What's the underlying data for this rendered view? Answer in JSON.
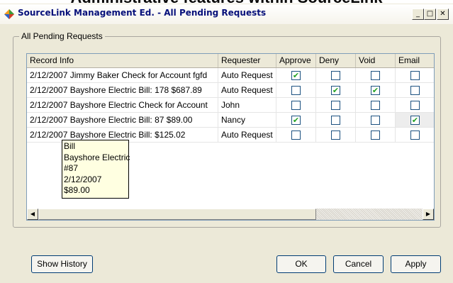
{
  "slide_heading": "Administrative features within SourceLink",
  "window": {
    "title": "SourceLink Management Ed. - All Pending Requests",
    "controls": {
      "minimize": "_",
      "maximize": "□",
      "close": "✕"
    }
  },
  "group": {
    "label": "All Pending Requests"
  },
  "table": {
    "columns": [
      "Record Info",
      "Requester",
      "Approve",
      "Deny",
      "Void",
      "Email"
    ],
    "rows": [
      {
        "record": "2/12/2007 Jimmy Baker Check for Account fgfd",
        "requester": "Auto Request",
        "approve": "✔",
        "deny": "",
        "void": "",
        "email": ""
      },
      {
        "record": "2/12/2007 Bayshore Electric Bill: 178 $687.89",
        "requester": "Auto Request",
        "approve": "",
        "deny": "✔",
        "void": "✔",
        "email": ""
      },
      {
        "record": "2/12/2007 Bayshore Electric Check for Account",
        "requester": "John",
        "approve": "",
        "deny": "",
        "void": "",
        "email": ""
      },
      {
        "record": "2/12/2007 Bayshore Electric Bill: 87 $89.00",
        "requester": "Nancy",
        "approve": "✔",
        "deny": "",
        "void": "",
        "email": "✔"
      },
      {
        "record": "2/12/2007 Bayshore Electric Bill:  $125.02",
        "requester": "Auto Request",
        "approve": "",
        "deny": "",
        "void": "",
        "email": ""
      }
    ]
  },
  "tooltip": {
    "lines": [
      "Bill",
      "Bayshore Electric",
      "#87",
      "2/12/2007",
      "$89.00"
    ]
  },
  "scrollbar": {
    "left_arrow": "◀",
    "right_arrow": "▶"
  },
  "buttons": {
    "show_history": "Show History",
    "ok": "OK",
    "cancel": "Cancel",
    "apply": "Apply"
  },
  "icons": {
    "app": "sourcelink-app-icon",
    "check": "checkmark-icon"
  }
}
